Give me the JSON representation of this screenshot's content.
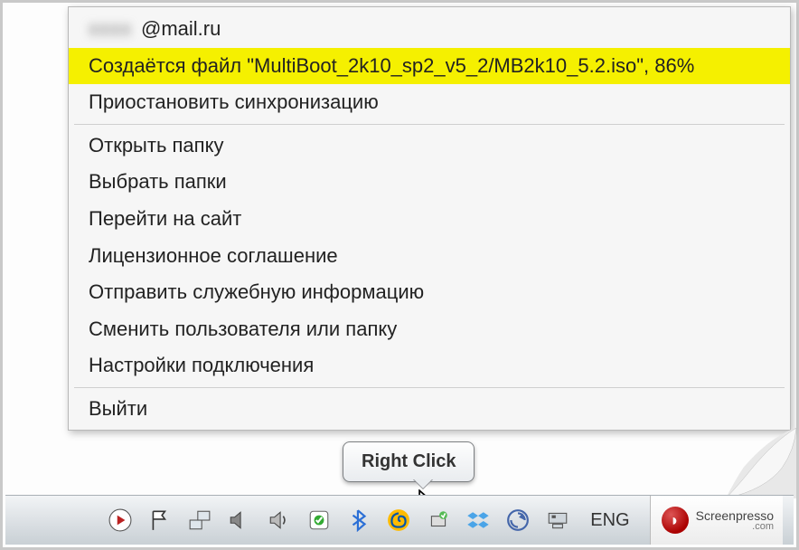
{
  "menu": {
    "email_suffix": "@mail.ru",
    "items": [
      "Создаётся файл \"MultiBoot_2k10_sp2_v5_2/MB2k10_5.2.iso\", 86%",
      "Приостановить синхронизацию",
      "Открыть папку",
      "Выбрать папки",
      "Перейти на сайт",
      "Лицензионное соглашение",
      "Отправить служебную информацию",
      "Сменить пользователя или папку",
      "Настройки подключения",
      "Выйти"
    ]
  },
  "annotation": {
    "label": "Right Click"
  },
  "taskbar": {
    "language": "ENG",
    "tray_icons": [
      "media",
      "action-center-flag",
      "network",
      "volume",
      "volume",
      "security-shield",
      "bluetooth",
      "mailru-cloud",
      "safely-remove",
      "dropbox",
      "sync",
      "device-manager"
    ]
  },
  "watermark": {
    "brand": "Screenpresso",
    "domain": ".com"
  }
}
